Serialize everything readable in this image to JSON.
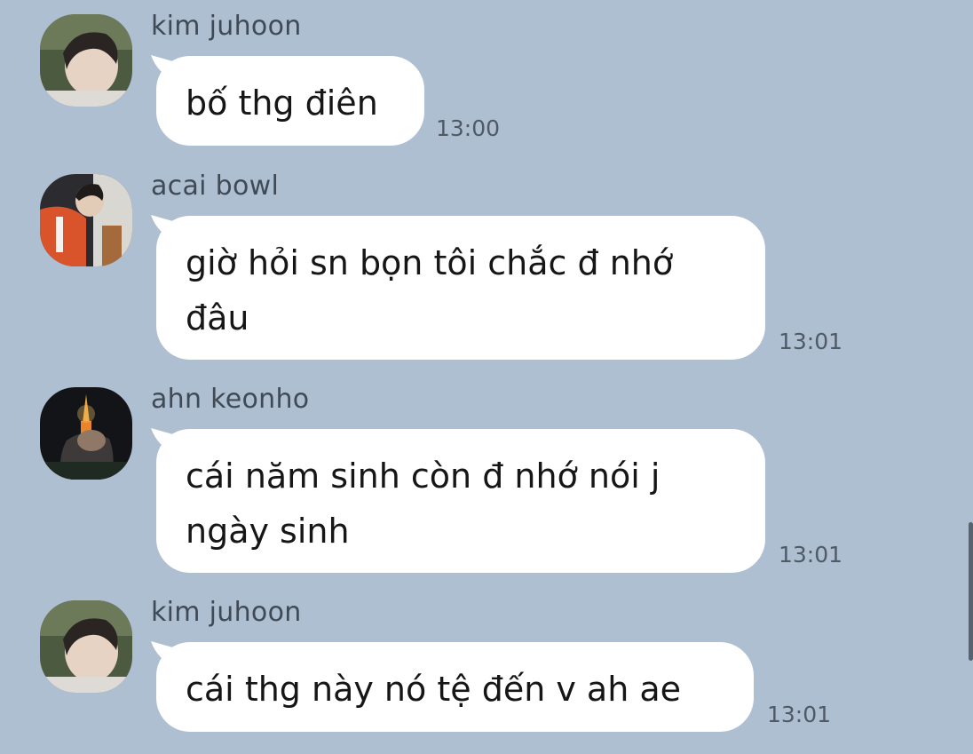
{
  "messages": [
    {
      "sender": "kim juhoon",
      "avatar": "avatar-kim-juhoon",
      "text": "bố thg điên",
      "time": "13:00"
    },
    {
      "sender": "acai bowl",
      "avatar": "avatar-acai-bowl",
      "text": "giờ hỏi sn bọn tôi chắc đ nhớ\nđâu",
      "time": "13:01"
    },
    {
      "sender": "ahn keonho",
      "avatar": "avatar-ahn-keonho",
      "text": "cái năm sinh còn đ nhớ nói j\nngày sinh",
      "time": "13:01"
    },
    {
      "sender": "kim juhoon",
      "avatar": "avatar-kim-juhoon",
      "text": "cái thg này nó tệ đến v ah ae",
      "time": "13:01"
    }
  ],
  "colors": {
    "background": "#aebfd1",
    "bubble": "#ffffff",
    "sender_text": "#3f4a56",
    "time_text": "#4f5a66"
  }
}
